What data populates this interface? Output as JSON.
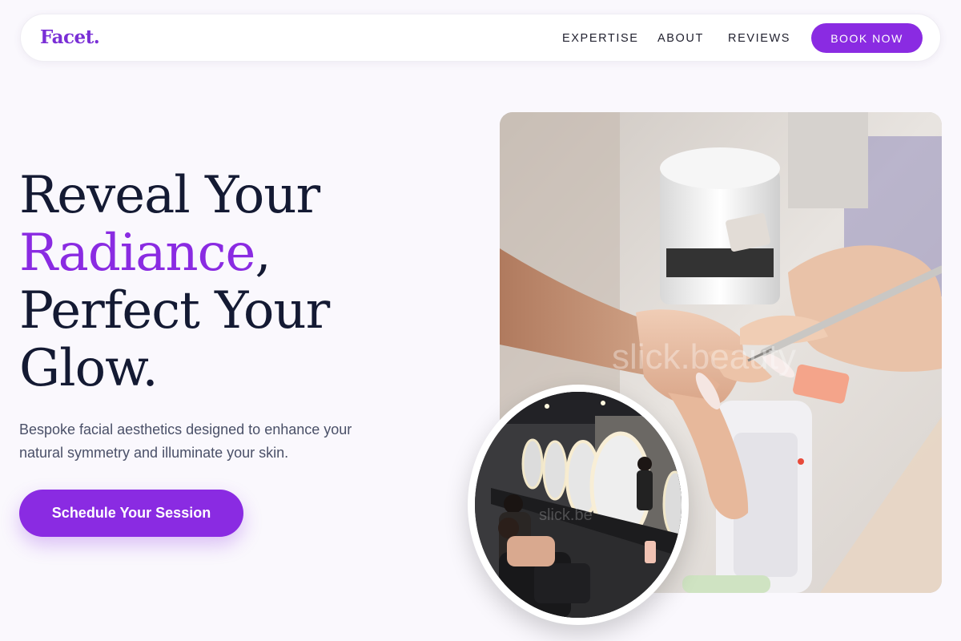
{
  "nav": {
    "logo": "Facet.",
    "links": [
      {
        "label": "EXPERTISE"
      },
      {
        "label": "ABOUT"
      },
      {
        "label": "REVIEWS"
      }
    ],
    "cta_label": "BOOK NOW"
  },
  "hero": {
    "headline_line1": "Reveal Your",
    "headline_accent": "Radiance",
    "headline_comma": ",",
    "headline_line3": "Perfect Your",
    "headline_line4": "Glow.",
    "subtext": "Bespoke facial aesthetics designed to enhance your natural symmetry and illuminate your skin.",
    "cta_label": "Schedule Your Session"
  },
  "images": {
    "main_watermark": "slick.beauty",
    "circle_watermark": "slick.be"
  },
  "colors": {
    "accent": "#8a2be2",
    "heading": "#141a33",
    "body_text": "#4a5068",
    "background": "#faf8fd"
  }
}
